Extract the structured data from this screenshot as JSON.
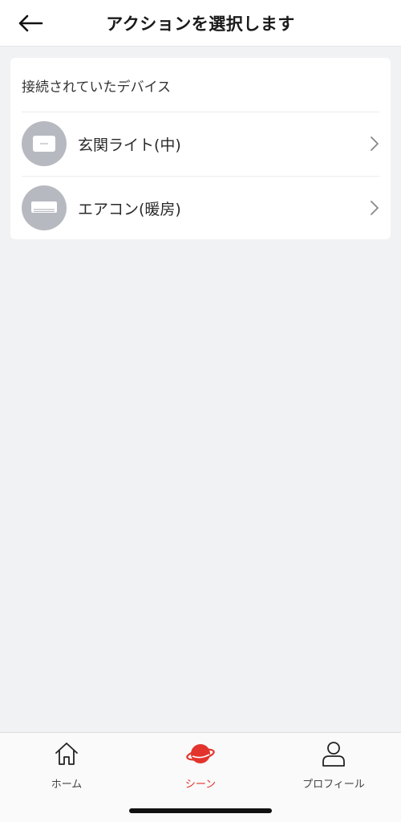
{
  "header": {
    "title": "アクションを選択します",
    "back_icon": "arrow-left-icon"
  },
  "device_list": {
    "heading": "接続されていたデバイス",
    "items": [
      {
        "label": "玄関ライト(中)",
        "icon": "light-panel-icon"
      },
      {
        "label": "エアコン(暖房)",
        "icon": "air-conditioner-icon"
      }
    ]
  },
  "tabbar": {
    "tabs": [
      {
        "label": "ホーム",
        "icon": "home-icon",
        "active": false
      },
      {
        "label": "シーン",
        "icon": "scene-planet-icon",
        "active": true
      },
      {
        "label": "プロフィール",
        "icon": "profile-icon",
        "active": false
      }
    ],
    "active_color": "#e2342d"
  }
}
